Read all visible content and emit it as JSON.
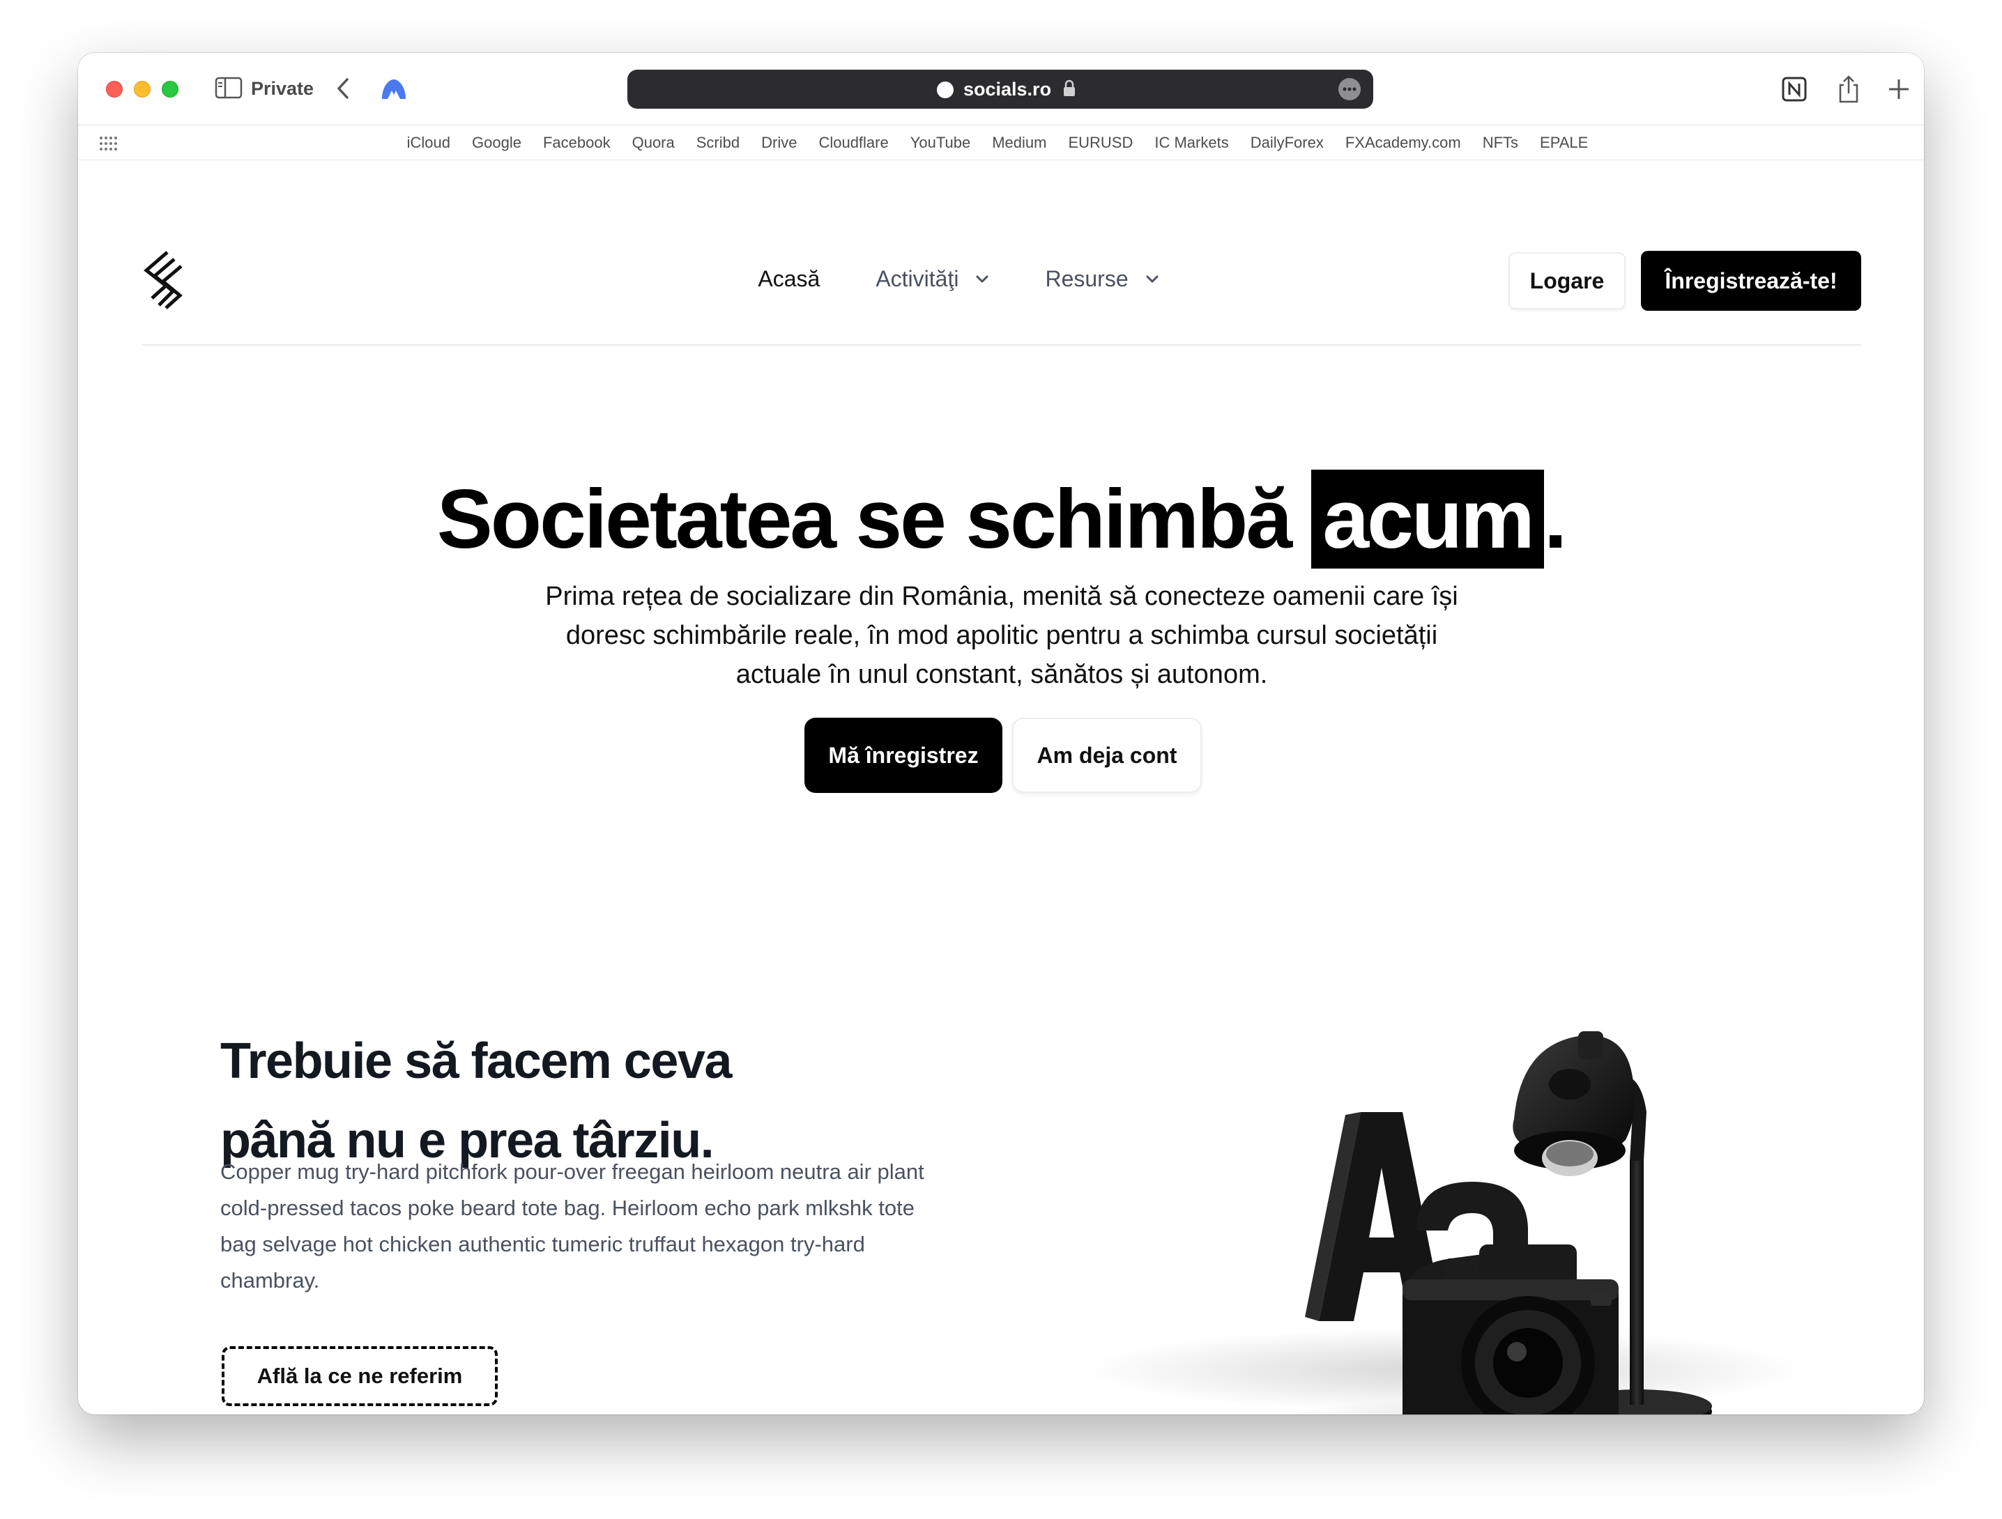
{
  "browser": {
    "private_label": "Private",
    "url": "socials.ro",
    "favorites": [
      "iCloud",
      "Google",
      "Facebook",
      "Quora",
      "Scribd",
      "Drive",
      "Cloudflare",
      "YouTube",
      "Medium",
      "EURUSD",
      "IC Markets",
      "DailyForex",
      "FXAcademy.com",
      "NFTs",
      "EPALE"
    ]
  },
  "header": {
    "nav": {
      "home": "Acasă",
      "activities": "Activităţi",
      "resources": "Resurse"
    },
    "login_label": "Logare",
    "register_label": "Înregistrează-te!"
  },
  "hero": {
    "title_main": "Societatea se schimbă ",
    "title_highlight": "acum",
    "title_end": ".",
    "subtitle": "Prima rețea de socializare din România, menită să conecteze oamenii care își doresc schimbările reale, în mod apolitic pentru a schimba cursul societății actuale în unul constant, sănătos și autonom.",
    "primary_button": "Mă înregistrez",
    "secondary_button": "Am deja cont"
  },
  "section": {
    "title_line1": "Trebuie să facem ceva",
    "title_line2": "până nu e prea târziu.",
    "body": "Copper mug try-hard pitchfork pour-over freegan heirloom neutra air plant cold-pressed tacos poke beard tote bag. Heirloom echo park mlkshk tote bag selvage hot chicken authentic tumeric truffaut hexagon try-hard chambray.",
    "button_label": "Află la ce ne referim",
    "illustration_letters": "Aa"
  },
  "colors": {
    "brand_black": "#000000",
    "muted_text": "#4a5160",
    "url_bar": "#2c2c2e"
  }
}
